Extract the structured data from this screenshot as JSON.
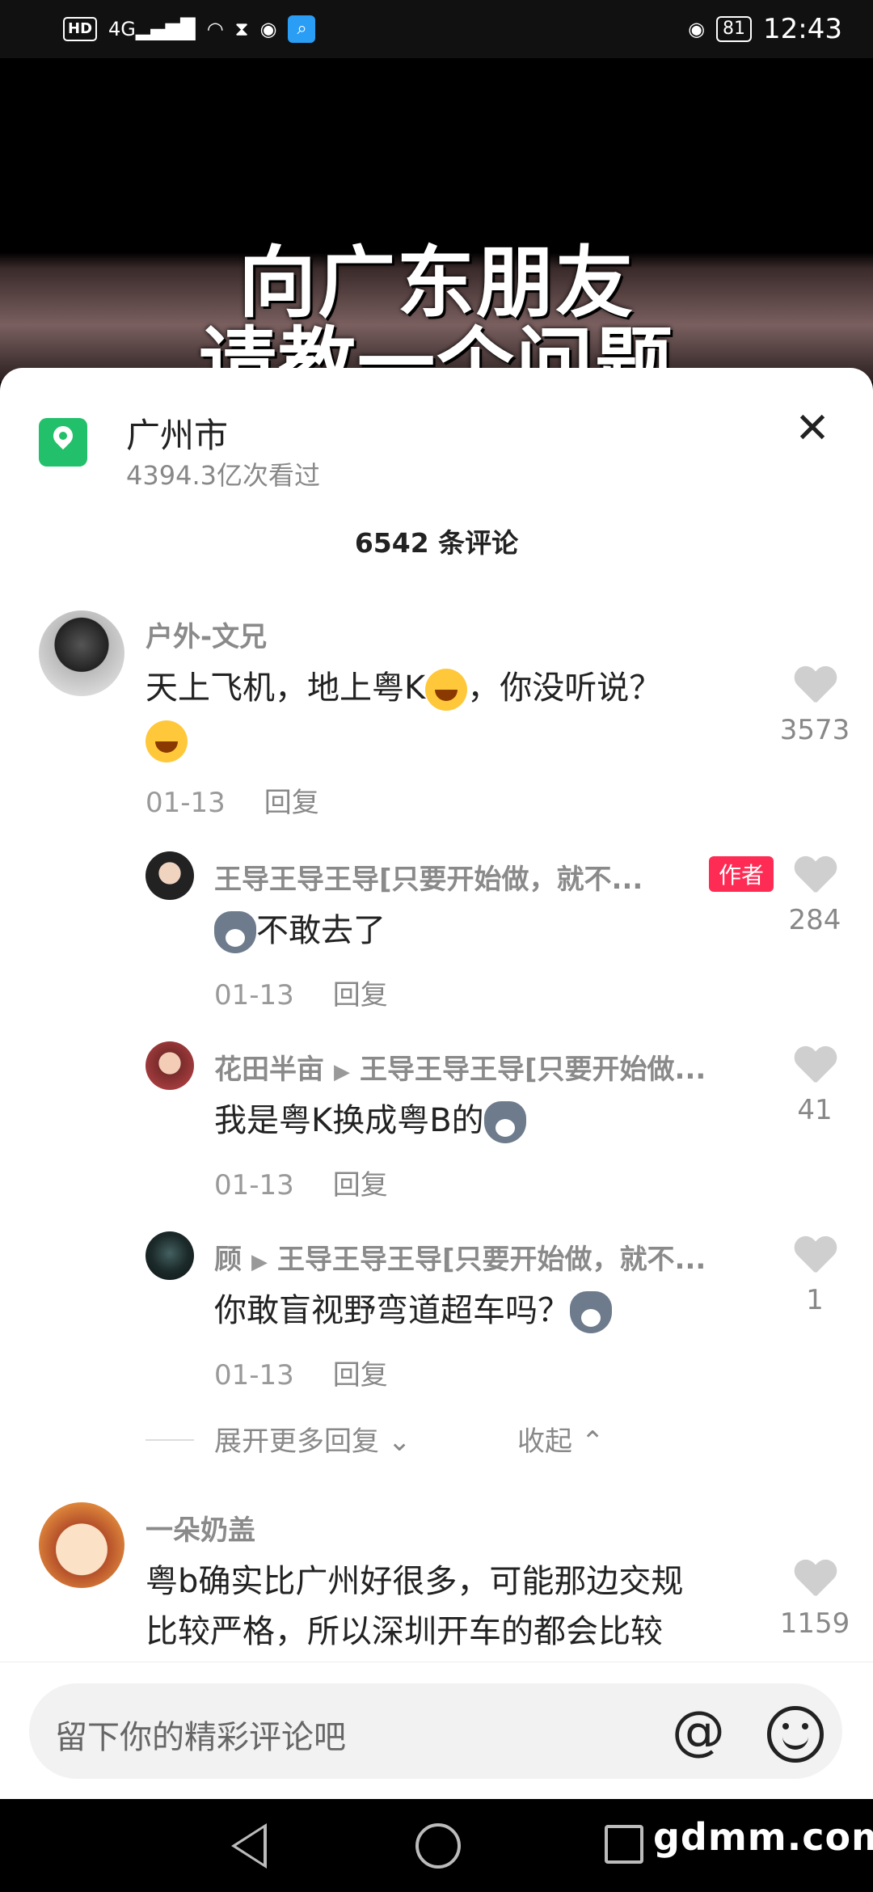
{
  "status_bar": {
    "left_icons": [
      "HD",
      "4G",
      "signal-bars",
      "wifi",
      "hourglass",
      "wechat",
      "search"
    ],
    "battery": "81",
    "time": "12:43"
  },
  "video": {
    "line1": "向广东朋友",
    "line2": "请教一个问题"
  },
  "location": {
    "title": "广州市",
    "views": "4394.3亿次看过"
  },
  "comments_count": "6542 条评论",
  "comments": [
    {
      "user": "户外-文兄",
      "text": "天上飞机，地上粤K",
      "text2": "，你没听说？",
      "date": "01-13",
      "reply": "回复",
      "likes": "3573"
    },
    {
      "user": "王导王导王导[只要开始做，就不...",
      "tag": "作者",
      "text": "不敢去了",
      "date": "01-13",
      "reply": "回复",
      "likes": "284"
    },
    {
      "user": "花田半亩",
      "reply_to": "王导王导王导[只要开始做...",
      "text": "我是粤K换成粤B的",
      "date": "01-13",
      "reply": "回复",
      "likes": "41"
    },
    {
      "user": "顾",
      "reply_to": "王导王导王导[只要开始做，就不...",
      "text": "你敢盲视野弯道超车吗？",
      "date": "01-13",
      "reply": "回复",
      "likes": "1"
    },
    {
      "user": "一朵奶盖",
      "text": "粤b确实比广州好很多，可能那边交规",
      "text2": "比较严格，所以深圳开车的都会比较",
      "likes": "1159"
    }
  ],
  "expand_label": "展开更多回复",
  "collapse_label": "收起",
  "input": {
    "placeholder": "留下你的精彩评论吧",
    "at": "@"
  },
  "watermark": "gdmm.com",
  "colors": {
    "accent": "#fe2c55",
    "location_green": "#22c06a"
  }
}
